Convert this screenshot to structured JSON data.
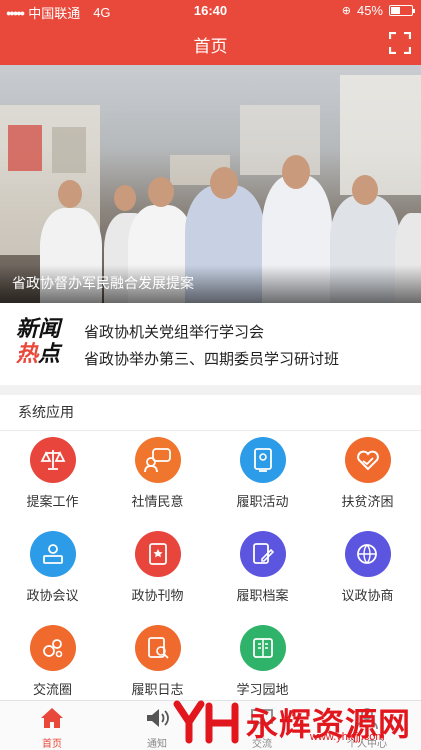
{
  "status_bar": {
    "carrier": "中国联通",
    "network": "4G",
    "time": "16:40",
    "battery": "45%",
    "battery_level": 0.45
  },
  "header": {
    "title": "首页",
    "scan_icon": "scan-icon"
  },
  "banner": {
    "caption": "省政协督办军民融合发展提案"
  },
  "news": {
    "logo_line1": "新闻",
    "logo_line2a": "热",
    "logo_line2b": "点",
    "items": [
      "省政协机关党组举行学习会",
      "省政协举办第三、四期委员学习研讨班"
    ]
  },
  "apps_section": {
    "title": "系统应用",
    "apps": [
      {
        "label": "提案工作",
        "icon": "scales-icon",
        "color": "#e8453c"
      },
      {
        "label": "社情民意",
        "icon": "chat-people-icon",
        "color": "#f0762e"
      },
      {
        "label": "履职活动",
        "icon": "certificate-icon",
        "color": "#2c9be8"
      },
      {
        "label": "扶贫济困",
        "icon": "heart-hand-icon",
        "color": "#f06a2e"
      },
      {
        "label": "政协会议",
        "icon": "speaker-podium-icon",
        "color": "#2c9be8"
      },
      {
        "label": "政协刊物",
        "icon": "book-star-icon",
        "color": "#e8453c"
      },
      {
        "label": "履职档案",
        "icon": "pen-document-icon",
        "color": "#5b55e0"
      },
      {
        "label": "议政协商",
        "icon": "globe-pen-icon",
        "color": "#5b55e0"
      },
      {
        "label": "交流圈",
        "icon": "circles-icon",
        "color": "#f06a2e"
      },
      {
        "label": "履职日志",
        "icon": "search-document-icon",
        "color": "#f06a2e"
      },
      {
        "label": "学习园地",
        "icon": "open-book-icon",
        "color": "#2fb36a"
      }
    ]
  },
  "tabbar": {
    "tabs": [
      {
        "label": "首页",
        "icon": "home-icon",
        "active": true
      },
      {
        "label": "通知",
        "icon": "speaker-icon",
        "active": false
      },
      {
        "label": "交流",
        "icon": "chat-icon",
        "active": false
      },
      {
        "label": "个人中心",
        "icon": "person-icon",
        "active": false
      }
    ]
  },
  "watermark": {
    "text": "永辉资源网",
    "url": "www.yhkjjj.com"
  }
}
